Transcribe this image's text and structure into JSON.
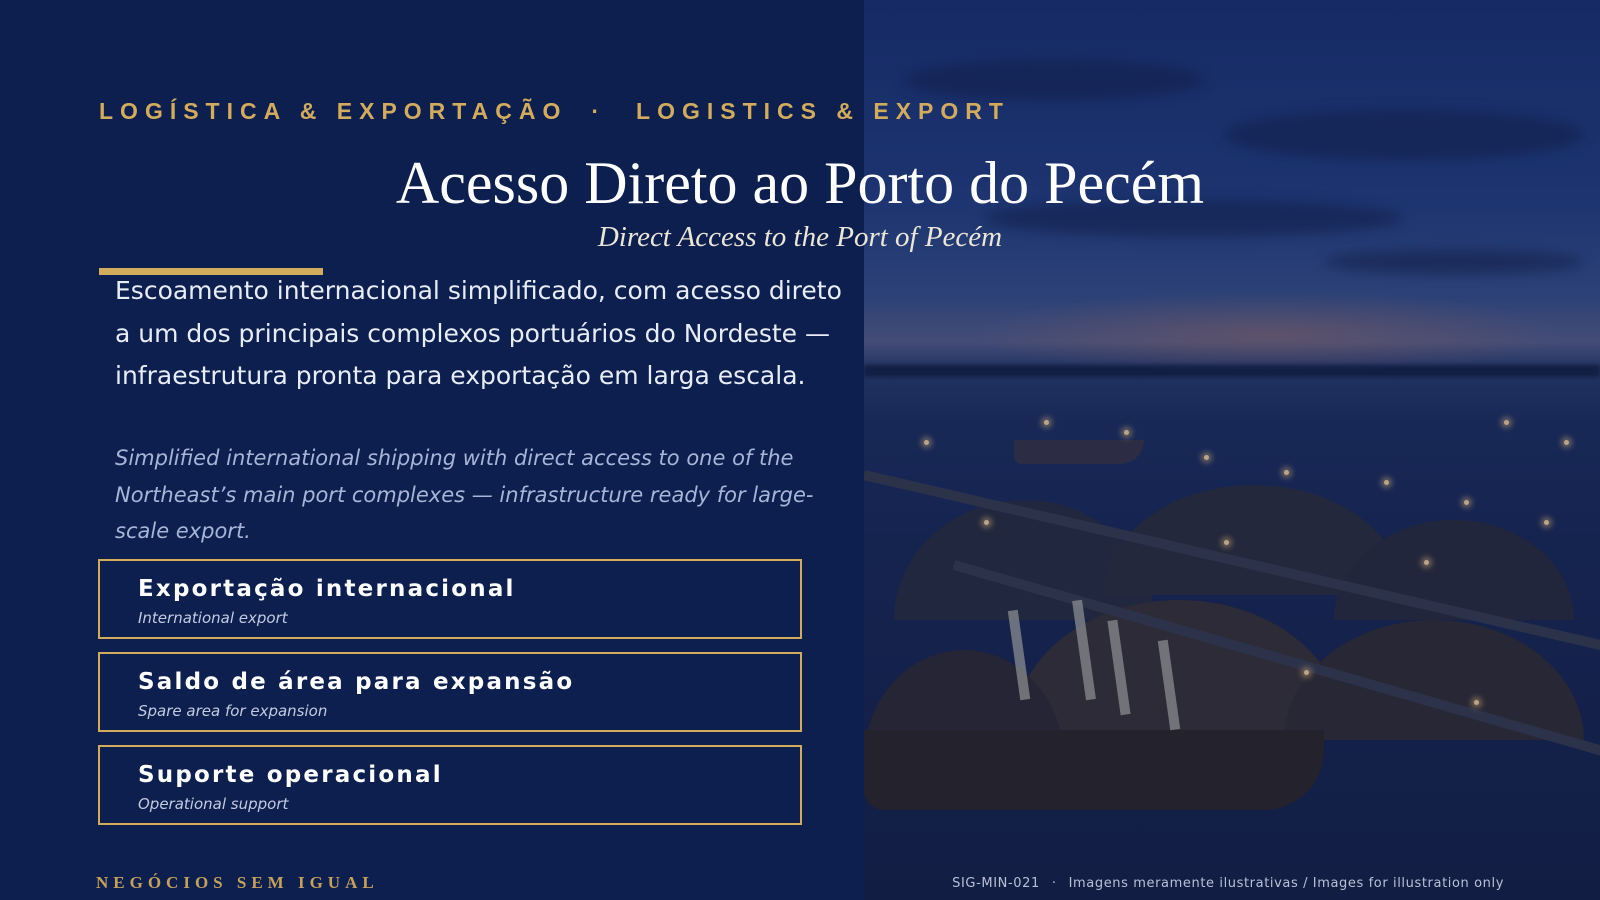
{
  "slide": {
    "overline": {
      "pt": "LOGÍSTICA & EXPORTAÇÃO",
      "separator": "·",
      "en": "LOGISTICS & EXPORT"
    },
    "title": "Acesso Direto ao Porto do Pecém",
    "subtitle": "Direct Access to the Port of Pecém",
    "body_pt": "Escoamento internacional simplificado, com acesso direto a um dos principais complexos portuários do Nordeste — infraestrutura pronta para exportação em larga escala.",
    "body_en": "Simplified international shipping with direct access to one of the Northeast’s main port complexes — infrastructure ready for large-scale export.",
    "features": [
      {
        "pt": "Exportação internacional",
        "en": "International export"
      },
      {
        "pt": "Saldo de área para expansão",
        "en": "Spare area for expansion"
      },
      {
        "pt": "Suporte operacional",
        "en": "Operational support"
      }
    ],
    "brand": "NEGÓCIOS SEM IGUAL",
    "footer": {
      "code": "SIG-MIN-021",
      "separator": "·",
      "disclaimer": "Imagens meramente ilustrativas / Images for illustration only"
    }
  },
  "photo": {
    "subject": "port-at-dusk-image"
  },
  "colors": {
    "background": "#0c1f4f",
    "gold": "#d2ac5c",
    "text": "#ffffff",
    "muted_text": "#a7b5d6"
  }
}
